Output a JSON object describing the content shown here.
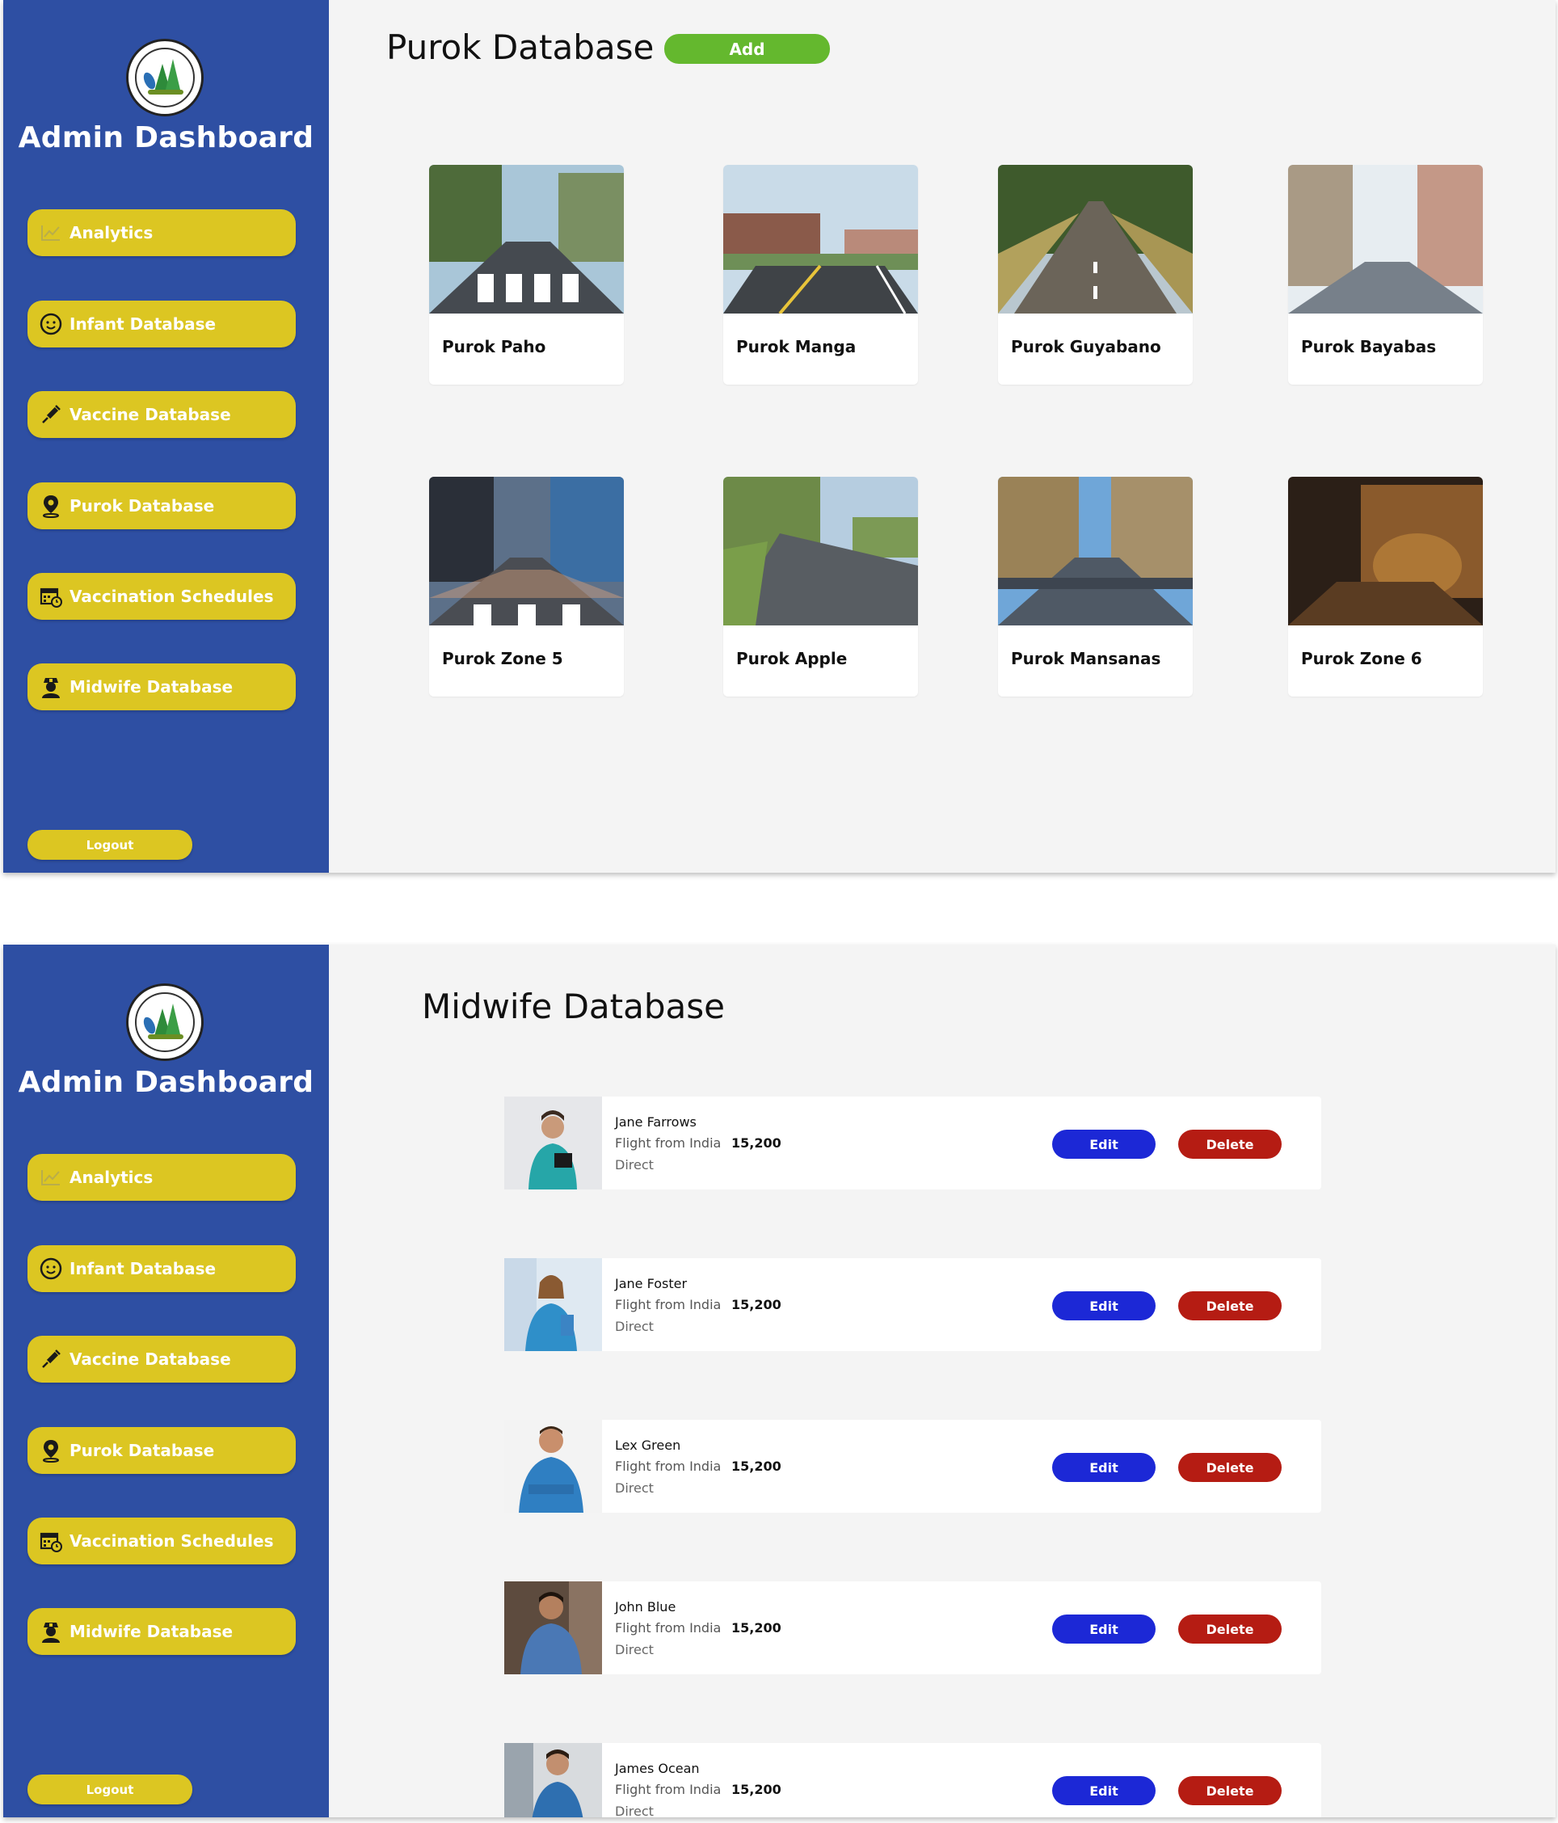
{
  "brand": {
    "title": "Admin Dashboard",
    "logo_text": "BARANGAY CANLANDOG MURCIA"
  },
  "nav": [
    {
      "label": "Analytics",
      "icon": "chart-line-icon"
    },
    {
      "label": "Infant Database",
      "icon": "baby-face-icon"
    },
    {
      "label": "Vaccine Database",
      "icon": "syringe-icon"
    },
    {
      "label": "Purok Database",
      "icon": "location-pin-icon"
    },
    {
      "label": "Vaccination Schedules",
      "icon": "calendar-clock-icon"
    },
    {
      "label": "Midwife Database",
      "icon": "nurse-icon"
    }
  ],
  "logout_label": "Logout",
  "purok_page": {
    "title": "Purok Database",
    "add_label": "Add",
    "cards": [
      {
        "name": "Purok Paho"
      },
      {
        "name": "Purok Manga"
      },
      {
        "name": "Purok Guyabano"
      },
      {
        "name": "Purok Bayabas"
      },
      {
        "name": "Purok Zone 5"
      },
      {
        "name": "Purok Apple"
      },
      {
        "name": "Purok Mansanas"
      },
      {
        "name": "Purok Zone 6"
      }
    ]
  },
  "midwife_page": {
    "title": "Midwife Database",
    "edit_label": "Edit",
    "delete_label": "Delete",
    "rows": [
      {
        "name": "Jane Farrows",
        "route": "Flight from India",
        "price": "15,200",
        "stops": "Direct"
      },
      {
        "name": "Jane Foster",
        "route": "Flight from India",
        "price": "15,200",
        "stops": "Direct"
      },
      {
        "name": "Lex Green",
        "route": "Flight from India",
        "price": "15,200",
        "stops": "Direct"
      },
      {
        "name": "John Blue",
        "route": "Flight from India",
        "price": "15,200",
        "stops": "Direct"
      },
      {
        "name": "James Ocean",
        "route": "Flight from India",
        "price": "15,200",
        "stops": "Direct"
      }
    ]
  },
  "colors": {
    "sidebar": "#2e4fa3",
    "nav_button": "#dcc622",
    "add_button": "#64b82e",
    "edit_button": "#1c28d6",
    "delete_button": "#b51c13",
    "content_bg": "#f4f4f4"
  }
}
